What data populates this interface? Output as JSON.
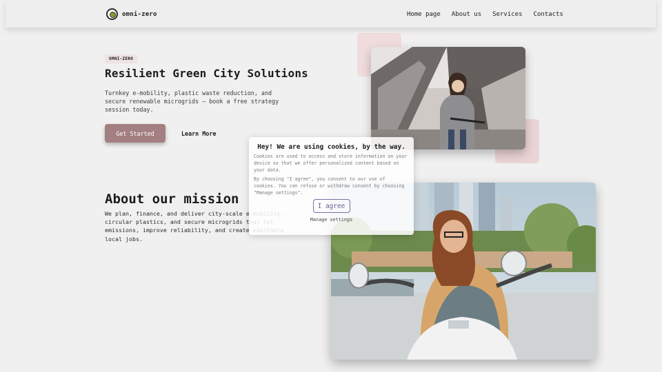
{
  "header": {
    "logo_text": "omni-zero",
    "nav": [
      "Home page",
      "About us",
      "Services",
      "Contacts"
    ]
  },
  "hero": {
    "tag": "OMNI-ZERO",
    "title": "Resilient Green City Solutions",
    "description": "Turnkey e-mobility, plastic waste reduction, and secure renewable microgrids — book a free strategy session today.",
    "primary_button": "Get Started",
    "secondary_button": "Learn More"
  },
  "mission": {
    "title": "About our mission",
    "text": "We plan, finance, and deliver city-scale e-mobility, circular plastics, and secure microgrids that cut emissions, improve reliability, and create equitable local jobs."
  },
  "cookie": {
    "title": "Hey! We are using cookies, by the way.",
    "text1": "Cookies are used to access and store information on your device so that we offer personalized content based on your data.",
    "text2": "By choosing \"I agree\", you consent to our use of cookies. You can refuse or withdraw consent by choosing \"Manage settings\".",
    "agree": "I agree",
    "manage": "Manage settings"
  },
  "colors": {
    "accent": "#a37f81",
    "tag_bg": "#efe2e3",
    "agree_border": "#7c6ea3"
  },
  "icons": [
    "logo-icon"
  ]
}
